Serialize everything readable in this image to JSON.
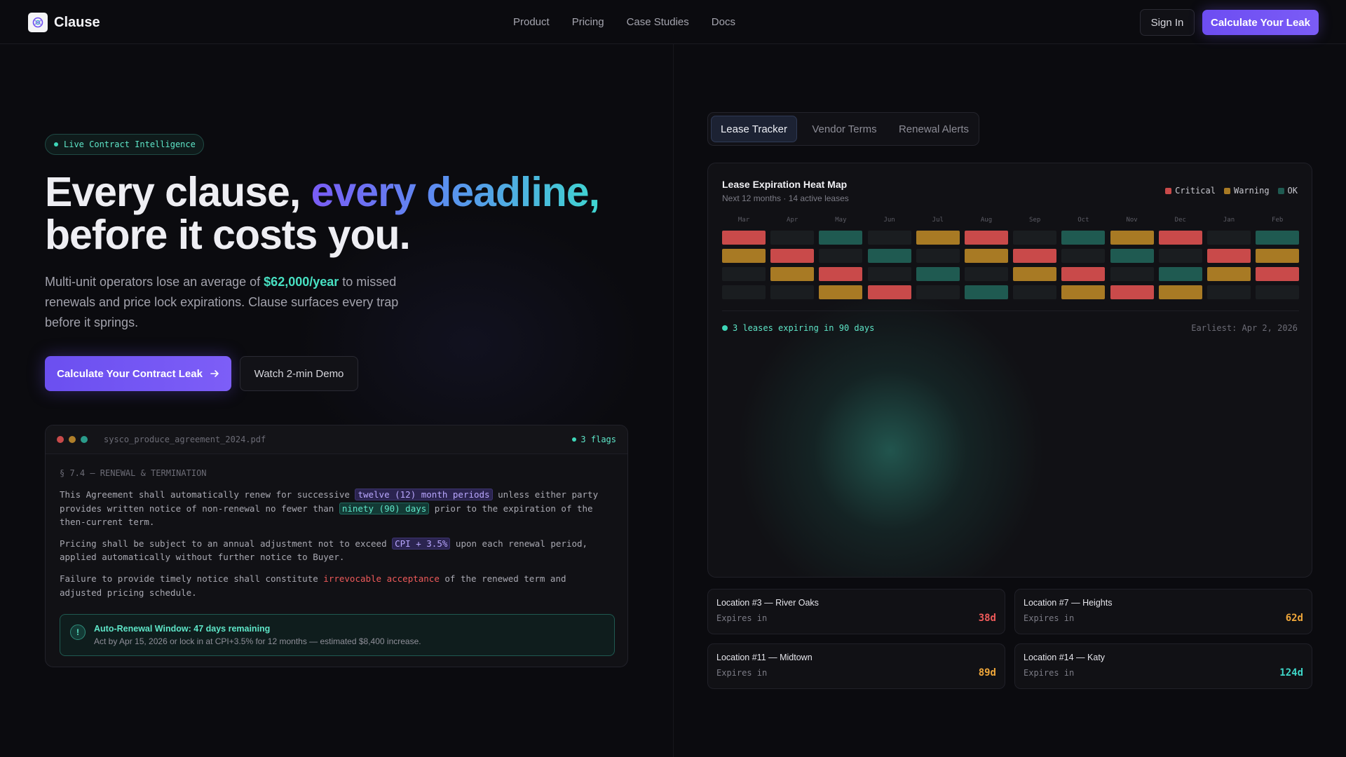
{
  "nav": {
    "brand": "Clause",
    "links": [
      "Product",
      "Pricing",
      "Case Studies",
      "Docs"
    ],
    "sign_in": "Sign In",
    "cta": "Calculate Your Leak"
  },
  "hero": {
    "pill": "Live Contract Intelligence",
    "title_part1": "Every clause, ",
    "title_highlight": "every deadline,",
    "title_part2": "before it costs you.",
    "sub_part1": "Multi-unit operators lose an average of ",
    "sub_highlight": "$62,000/year",
    "sub_part2": " to missed renewals and price lock expirations. Clause surfaces every trap before it springs.",
    "cta_primary": "Calculate Your Contract Leak",
    "cta_secondary": "Watch 2-min Demo"
  },
  "document": {
    "filename": "sysco_produce_agreement_2024.pdf",
    "flags": "3 flags",
    "section": "§ 7.4 — RENEWAL & TERMINATION",
    "p1_a": "This Agreement shall automatically renew for successive ",
    "p1_tag1": "twelve (12) month periods",
    "p1_b": " unless either party provides written notice of non-renewal no fewer than ",
    "p1_tag2": "ninety (90) days",
    "p1_c": " prior to the expiration of the then-current term.",
    "p2_a": "Pricing shall be subject to an annual adjustment not to exceed ",
    "p2_tag": "CPI + 3.5%",
    "p2_b": " upon each renewal period, applied automatically without further notice to Buyer.",
    "p3_a": "Failure to provide timely notice shall constitute ",
    "p3_tag": "irrevocable acceptance",
    "p3_b": " of the renewed term and adjusted pricing schedule.",
    "alert_icon": "!",
    "alert_title": "Auto-Renewal Window: 47 days remaining",
    "alert_sub": "Act by Apr 15, 2026 or lock in at CPI+3.5% for 12 months — estimated $8,400 increase."
  },
  "tabs": [
    "Lease Tracker",
    "Vendor Terms",
    "Renewal Alerts"
  ],
  "heatmap": {
    "title": "Lease Expiration Heat Map",
    "subtitle": "Next 12 months · 14 active leases",
    "legend": [
      {
        "label": "Critical",
        "color": "#c94a4a"
      },
      {
        "label": "Warning",
        "color": "#a87a24"
      },
      {
        "label": "OK",
        "color": "#1f5a51"
      }
    ],
    "months": [
      "Mar",
      "Apr",
      "May",
      "Jun",
      "Jul",
      "Aug",
      "Sep",
      "Oct",
      "Nov",
      "Dec",
      "Jan",
      "Feb"
    ],
    "rows": [
      [
        "critical",
        "empty",
        "ok",
        "empty",
        "warning",
        "critical",
        "empty",
        "ok",
        "warning",
        "critical",
        "empty",
        "ok"
      ],
      [
        "warning",
        "critical",
        "empty",
        "ok",
        "empty",
        "warning",
        "critical",
        "empty",
        "ok",
        "empty",
        "critical",
        "warning"
      ],
      [
        "empty",
        "warning",
        "critical",
        "empty",
        "ok",
        "empty",
        "warning",
        "critical",
        "empty",
        "ok",
        "warning",
        "critical"
      ],
      [
        "empty",
        "empty",
        "warning",
        "critical",
        "empty",
        "ok",
        "empty",
        "warning",
        "critical",
        "warning",
        "empty",
        "empty"
      ]
    ],
    "footer": "3 leases expiring in 90 days",
    "earliest": "Earliest: Apr 2, 2026"
  },
  "locations": [
    {
      "name": "Location #3 — River Oaks",
      "label": "Expires in",
      "value": "38d",
      "color": "#ef5a5a"
    },
    {
      "name": "Location #7 — Heights",
      "label": "Expires in",
      "value": "62d",
      "color": "#f0a73a"
    },
    {
      "name": "Location #11 — Midtown",
      "label": "Expires in",
      "value": "89d",
      "color": "#f0a73a"
    },
    {
      "name": "Location #14 — Katy",
      "label": "Expires in",
      "value": "124d",
      "color": "#3ed6c8"
    }
  ],
  "colors": {
    "critical": "#c94a4a",
    "warning": "#a87a24",
    "ok": "#1f5a51",
    "empty": "#1a1d20",
    "accent": "#7b5cf6",
    "teal": "#3ed6b8"
  }
}
